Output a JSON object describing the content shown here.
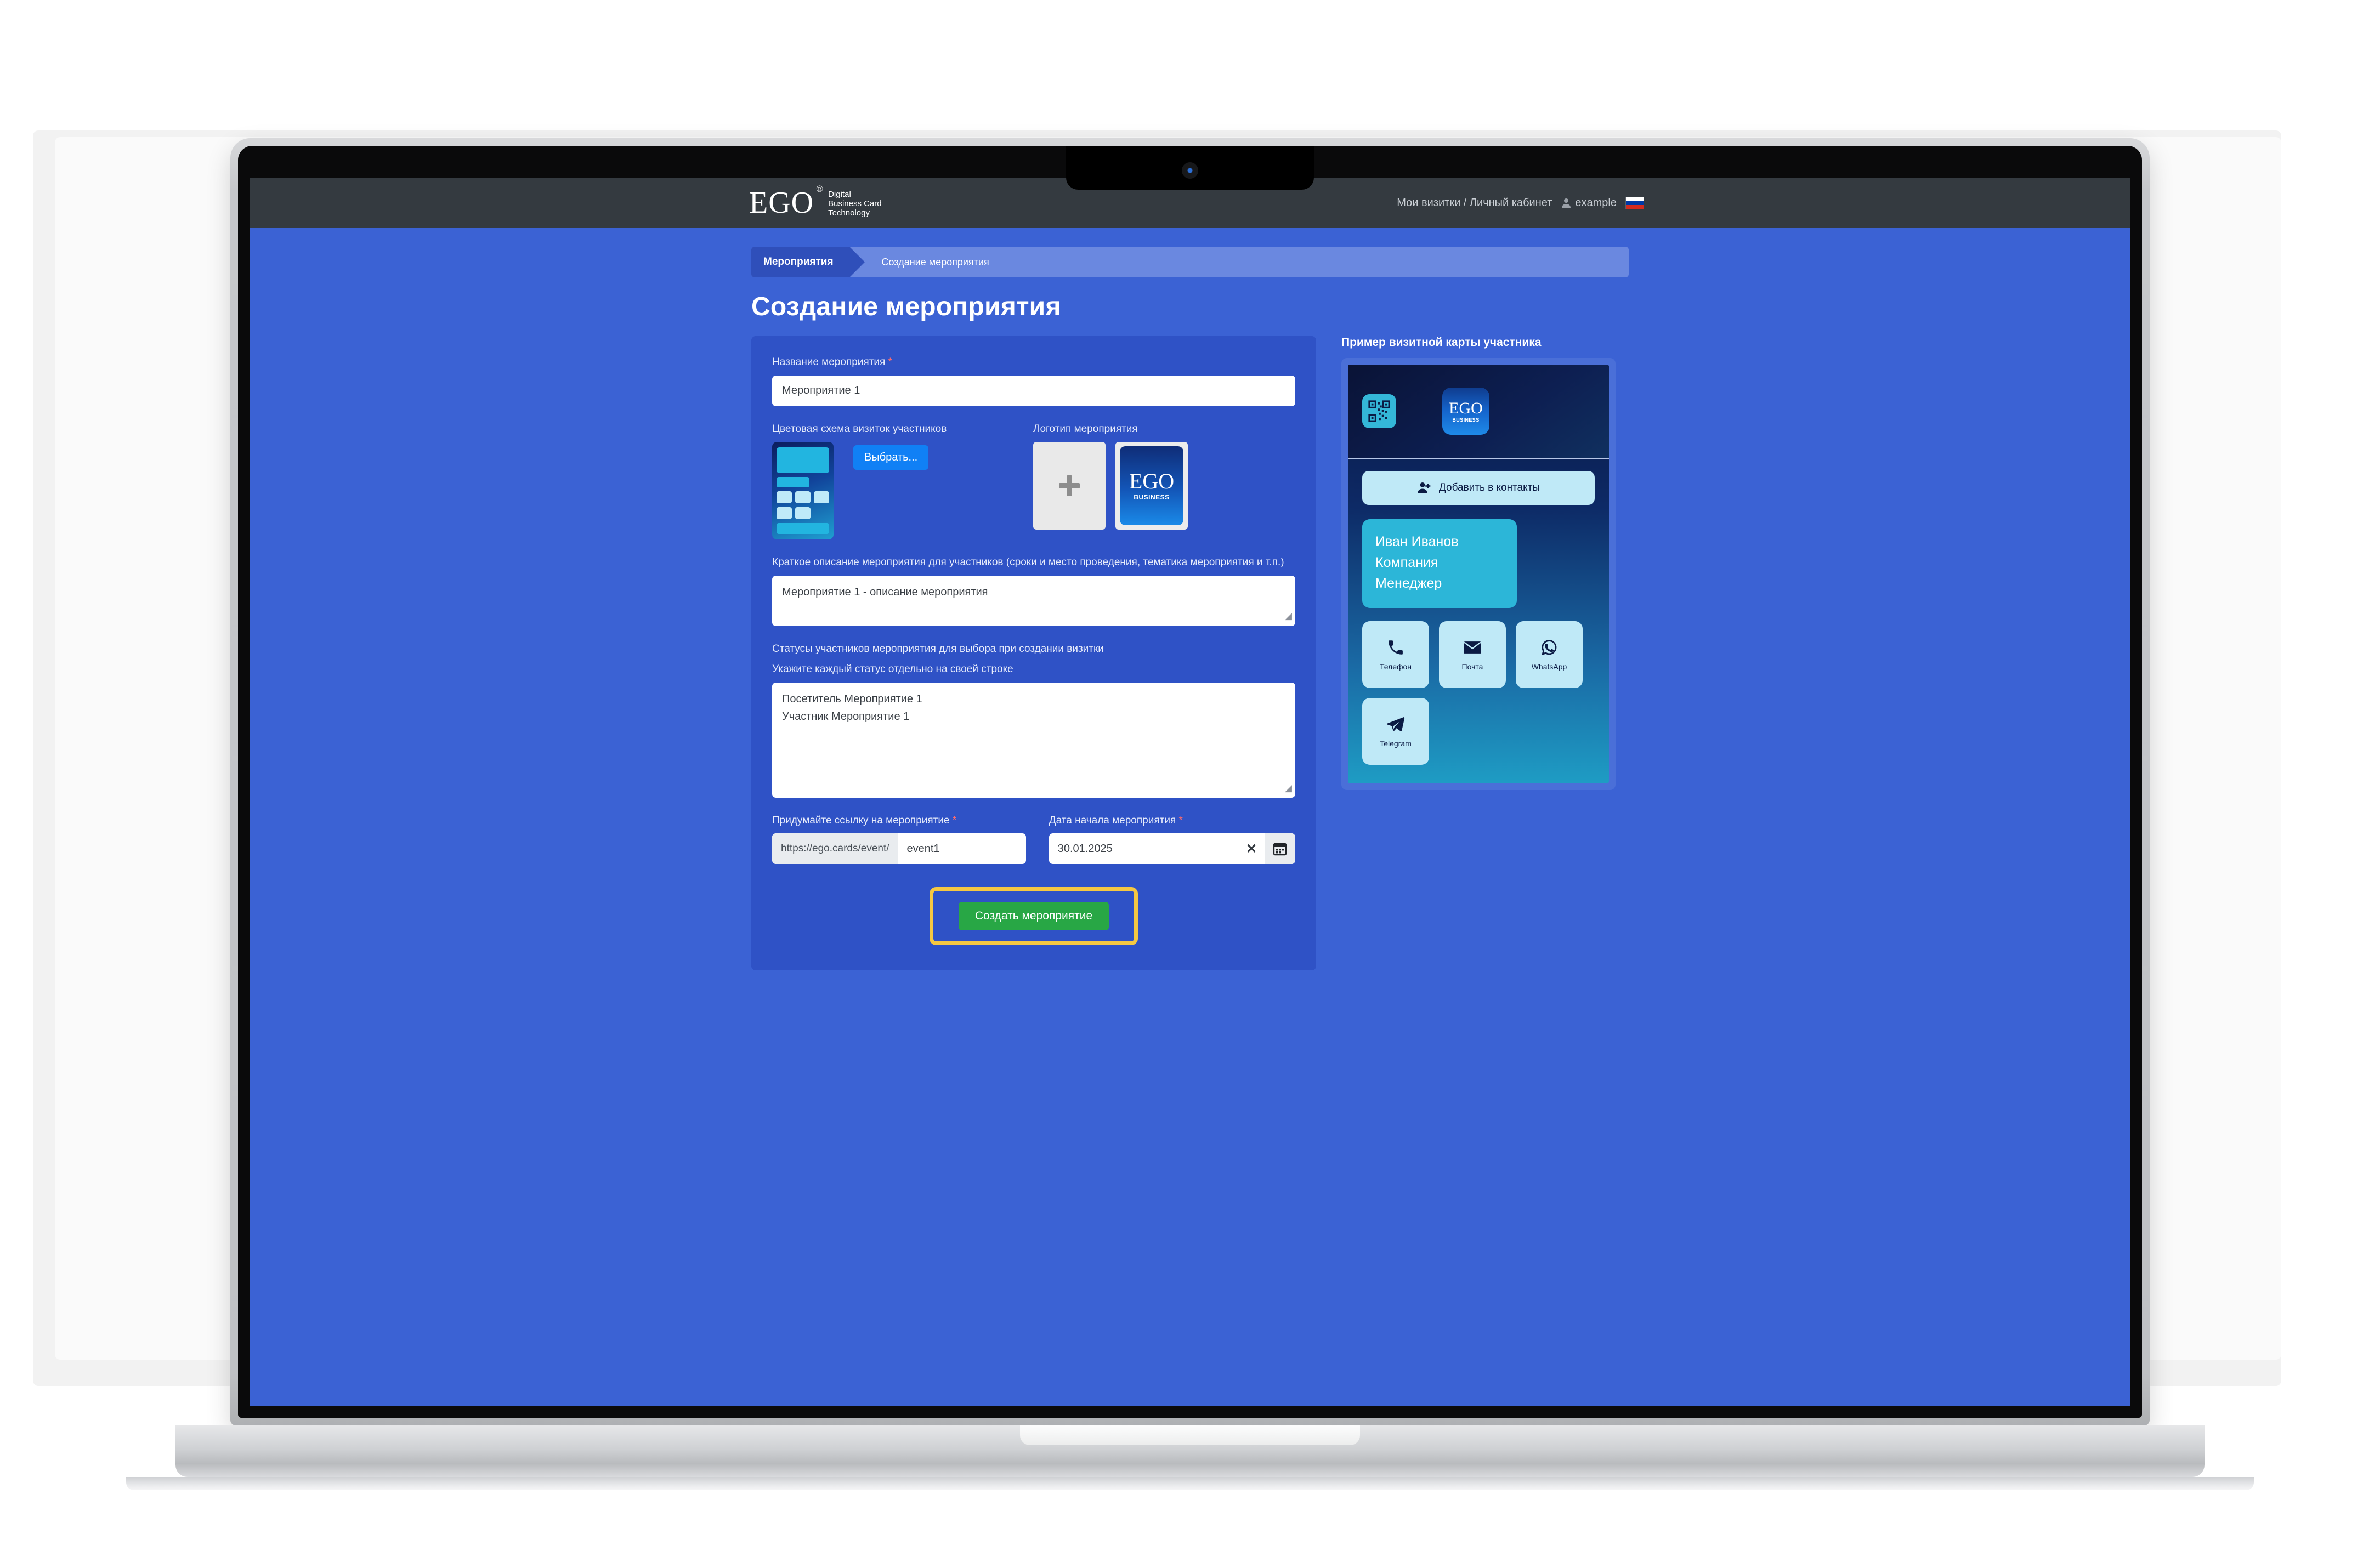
{
  "header": {
    "brand_name": "EGO",
    "brand_registered": "®",
    "brand_tagline": "Digital\nBusiness Card\nTechnology",
    "nav_link": "Мои визитки / Личный кабинет",
    "user_name": "example",
    "user_icon": "person-icon",
    "flag_icon": "russia-flag-icon"
  },
  "breadcrumb": {
    "active": "Мероприятия",
    "current": "Создание мероприятия"
  },
  "page_title": "Создание мероприятия",
  "form": {
    "name_label": "Название мероприятия",
    "name_required": "*",
    "name_value": "Мероприятие 1",
    "scheme_label": "Цветовая схема визиток участников",
    "choose_button": "Выбрать...",
    "logo_label": "Логотип мероприятия",
    "logo_upload_icon": "plus-icon",
    "logo_brand_big": "EGO",
    "logo_brand_small": "BUSINESS",
    "description_label": "Краткое описание мероприятия для участников (сроки и место проведения, тематика мероприятия и т.п.)",
    "description_value": "Мероприятие 1 - описание мероприятия",
    "statuses_label_1": "Статусы участников мероприятия для выбора при создании визитки",
    "statuses_label_2": "Укажите каждый статус отдельно на своей строке",
    "statuses_value": "Посетитель Мероприятие 1\nУчастник Мероприятие 1",
    "url_label": "Придумайте ссылку на мероприятие",
    "url_required": "*",
    "url_prefix": "https://ego.cards/event/",
    "url_value": "event1",
    "date_label": "Дата начала мероприятия",
    "date_required": "*",
    "date_value": "30.01.2025",
    "date_clear_icon": "close-icon",
    "date_calendar_icon": "calendar-icon",
    "submit_button": "Создать мероприятие"
  },
  "preview": {
    "title": "Пример визитной карты участника",
    "qr_icon": "qr-code-icon",
    "logo_big": "EGO",
    "logo_small": "BUSINESS",
    "add_contacts_label": "Добавить в контакты",
    "add_contacts_icon": "person-add-icon",
    "person_name": "Иван Иванов",
    "person_company": "Компания",
    "person_role": "Менеджер",
    "tiles": [
      {
        "label": "Телефон",
        "icon": "phone-icon"
      },
      {
        "label": "Почта",
        "icon": "envelope-icon"
      },
      {
        "label": "WhatsApp",
        "icon": "whatsapp-icon"
      },
      {
        "label": "Telegram",
        "icon": "telegram-icon"
      }
    ]
  },
  "colors": {
    "page_bg": "#3b62d4",
    "panel_bg": "#2f52c6",
    "header_bg": "#343a40",
    "accent_green": "#28a745",
    "accent_blue": "#1080f5",
    "highlight_yellow": "#f5c842",
    "cyan": "#2cb6d8",
    "light_cyan": "#bfe9f7"
  }
}
